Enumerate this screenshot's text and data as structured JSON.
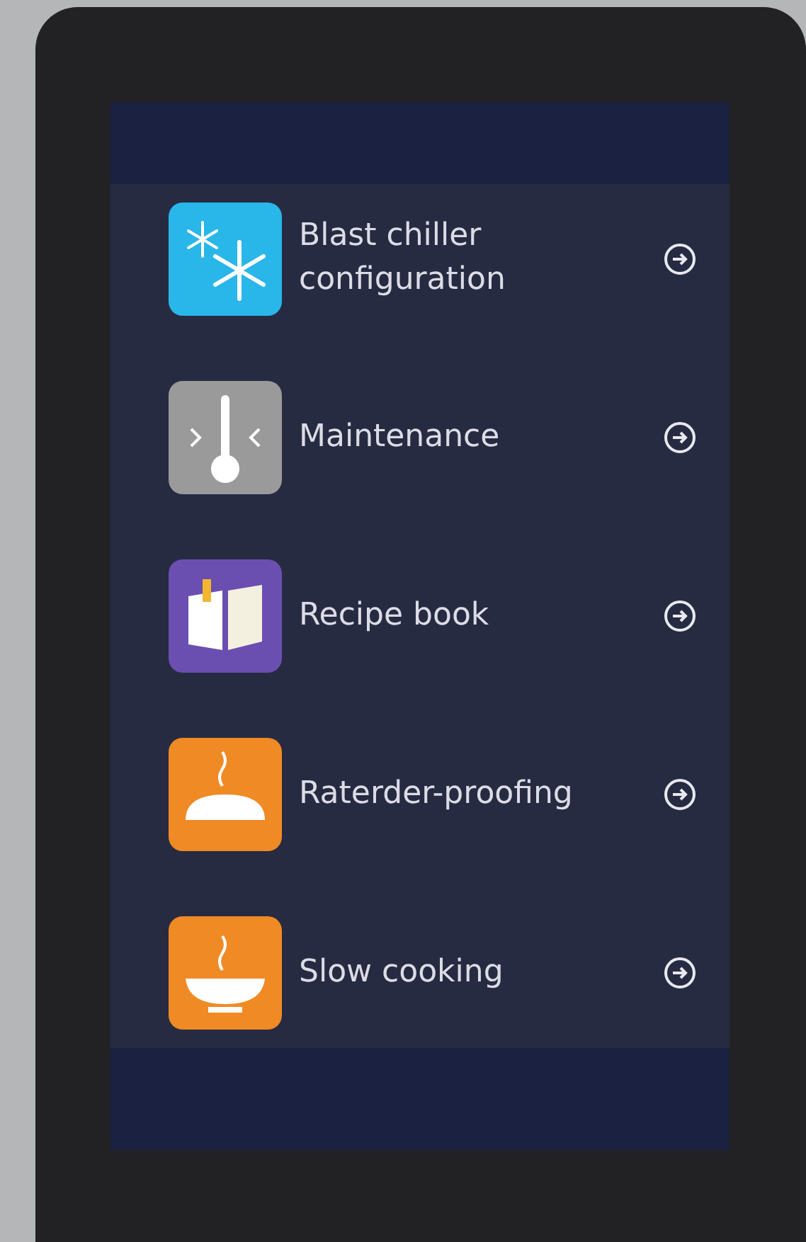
{
  "menu": {
    "items": [
      {
        "label": "Blast chiller configuration",
        "kind": "snowflake",
        "color": "#29b6e8"
      },
      {
        "label": "Maintenance",
        "kind": "thermometer",
        "color": "#9a9a9a"
      },
      {
        "label": "Recipe book",
        "kind": "book",
        "color": "#6a4fb0"
      },
      {
        "label": "Raterder-proofing",
        "kind": "bread",
        "color": "#f08a24"
      },
      {
        "label": "Slow cooking",
        "kind": "bowl",
        "color": "#f08a24"
      }
    ]
  }
}
